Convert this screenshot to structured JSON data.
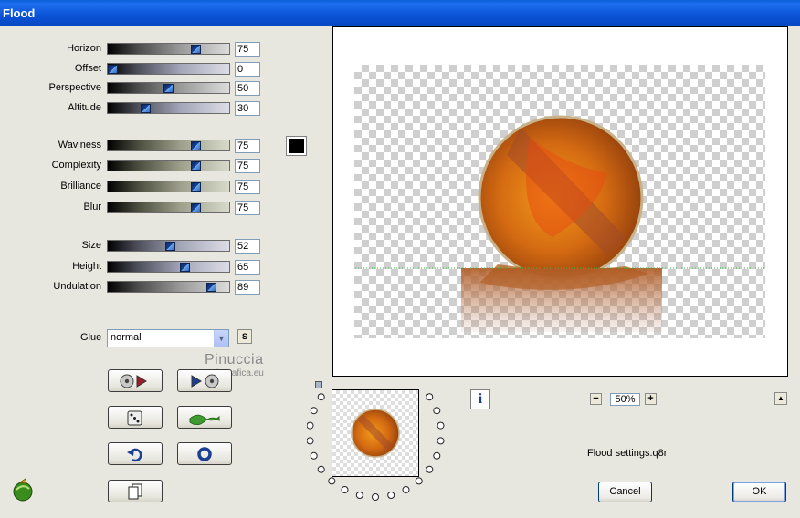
{
  "window": {
    "title": "Flood"
  },
  "sliders_group1": [
    {
      "label": "Horizon",
      "value": "75",
      "pct": 75,
      "style": "grey"
    },
    {
      "label": "Offset",
      "value": "0",
      "pct": 0,
      "style": "blue"
    },
    {
      "label": "Perspective",
      "value": "50",
      "pct": 50,
      "style": "grey"
    },
    {
      "label": "Altitude",
      "value": "30",
      "pct": 30,
      "style": "blue"
    }
  ],
  "sliders_group2": [
    {
      "label": "Waviness",
      "value": "75",
      "pct": 75,
      "style": "olive"
    },
    {
      "label": "Complexity",
      "value": "75",
      "pct": 75,
      "style": "olive"
    },
    {
      "label": "Brilliance",
      "value": "75",
      "pct": 75,
      "style": "olive"
    },
    {
      "label": "Blur",
      "value": "75",
      "pct": 75,
      "style": "olive"
    }
  ],
  "sliders_group3": [
    {
      "label": "Size",
      "value": "52",
      "pct": 52,
      "style": "blue"
    },
    {
      "label": "Height",
      "value": "65",
      "pct": 65,
      "style": "blue"
    },
    {
      "label": "Undulation",
      "value": "89",
      "pct": 89,
      "style": "grey"
    }
  ],
  "color_swatch": "#000000",
  "glue": {
    "label": "Glue",
    "value": "normal",
    "s_button": "S"
  },
  "watermark": {
    "name": "Pinuccia",
    "url": "www.mariagrafica.eu"
  },
  "zoom": {
    "value": "50%",
    "minus": "−",
    "plus": "+"
  },
  "info_label": "i",
  "up_label": "▲",
  "settings_file": "Flood settings.q8r",
  "buttons": {
    "cancel": "Cancel",
    "ok": "OK"
  }
}
